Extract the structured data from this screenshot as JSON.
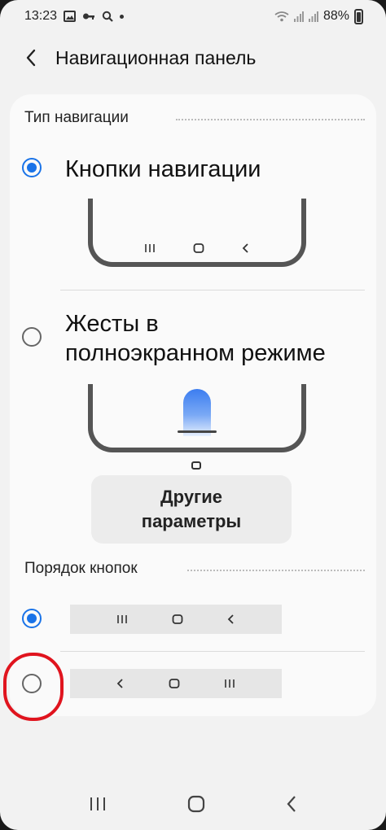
{
  "status_bar": {
    "time": "13:23",
    "battery": "88%",
    "icons": [
      "gallery-icon",
      "key-icon",
      "search-icon",
      "dot-icon",
      "wifi-icon",
      "signal-icon",
      "signal-icon",
      "battery-icon"
    ]
  },
  "header": {
    "back_icon": "chevron-left-icon",
    "title": "Навигационная панель"
  },
  "navigation_type": {
    "section_title": "Тип навигации",
    "options": [
      {
        "label": "Кнопки навигации",
        "selected": true
      },
      {
        "label_line1": "Жесты в",
        "label_line2": "полноэкранном режиме",
        "selected": false
      }
    ],
    "more_button": {
      "line1": "Другие",
      "line2": "параметры"
    }
  },
  "button_order": {
    "section_title": "Порядок кнопок",
    "options": [
      {
        "order": [
          "recents-icon",
          "home-icon",
          "back-icon"
        ],
        "selected": true
      },
      {
        "order": [
          "back-icon",
          "home-icon",
          "recents-icon"
        ],
        "selected": false
      }
    ]
  },
  "colors": {
    "accent": "#1a73e8",
    "highlight": "#e0141e",
    "background": "#f2f2f2",
    "card": "#fafafa"
  },
  "system_nav": [
    "recents-icon",
    "home-icon",
    "back-icon"
  ]
}
